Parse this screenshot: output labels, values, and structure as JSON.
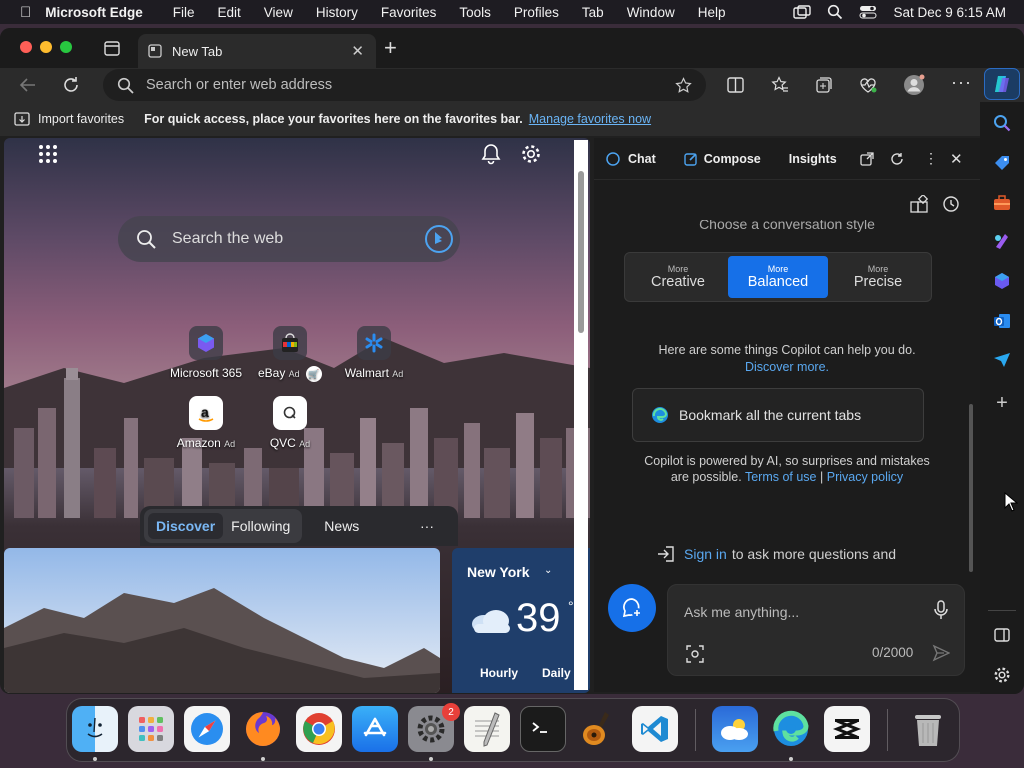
{
  "colors": {
    "accent": "#1670e8",
    "link": "#6ab4f5",
    "window_bg": "#202020",
    "menubar_bg": "#1e1c22"
  },
  "menubar": {
    "items": [
      "Microsoft Edge",
      "File",
      "Edit",
      "View",
      "History",
      "Favorites",
      "Tools",
      "Profiles",
      "Tab",
      "Window",
      "Help"
    ],
    "datetime": "Sat Dec 9  6:15 AM"
  },
  "tab": {
    "title": "New Tab"
  },
  "omnibox": {
    "placeholder": "Search or enter web address"
  },
  "favbar": {
    "import_label": "Import favorites",
    "message": "For quick access, place your favorites here on the favorites bar.",
    "manage_link": "Manage favorites now"
  },
  "ntp": {
    "search_placeholder": "Search the web",
    "tiles": [
      {
        "label": "Microsoft 365",
        "ad": "",
        "icon": "microsoft365-icon"
      },
      {
        "label": "eBay",
        "ad": "Ad",
        "icon": "ebay-icon"
      },
      {
        "label": "Walmart",
        "ad": "Ad",
        "icon": "walmart-icon"
      },
      {
        "label": "Amazon",
        "ad": "Ad",
        "icon": "amazon-icon"
      },
      {
        "label": "QVC",
        "ad": "Ad",
        "icon": "qvc-icon"
      }
    ],
    "feed_tabs": [
      "Discover",
      "Following",
      "News"
    ],
    "more": "···",
    "weather": {
      "city": "New York",
      "temp": "39",
      "unit": "°",
      "hourly": "Hourly",
      "daily": "Daily"
    }
  },
  "copilot": {
    "tabs": [
      "Chat",
      "Compose",
      "Insights"
    ],
    "style_title": "Choose a conversation style",
    "styles": [
      {
        "small": "More",
        "big": "Creative"
      },
      {
        "small": "More",
        "big": "Balanced"
      },
      {
        "small": "More",
        "big": "Precise"
      }
    ],
    "help_text": "Here are some things Copilot can help you do.",
    "discover_link": "Discover more.",
    "suggestion": "Bookmark all the current tabs",
    "disclaimer_1": "Copilot is powered by AI, so surprises and mistakes",
    "disclaimer_2": "are possible.",
    "terms": "Terms of use",
    "sep": "|",
    "privacy": "Privacy policy",
    "signin": "Sign in",
    "signin_rest": "to ask more questions and",
    "ask_placeholder": "Ask me anything...",
    "counter": "0/2000"
  },
  "dock": {
    "apps": [
      "Finder",
      "Launchpad",
      "Safari",
      "Firefox",
      "Chrome",
      "App Store",
      "System Settings",
      "TextEdit",
      "Terminal",
      "GarageBand",
      "Visual Studio Code",
      "Weather",
      "Microsoft Edge",
      "CapCut",
      "Trash"
    ],
    "settings_badge": "2"
  }
}
